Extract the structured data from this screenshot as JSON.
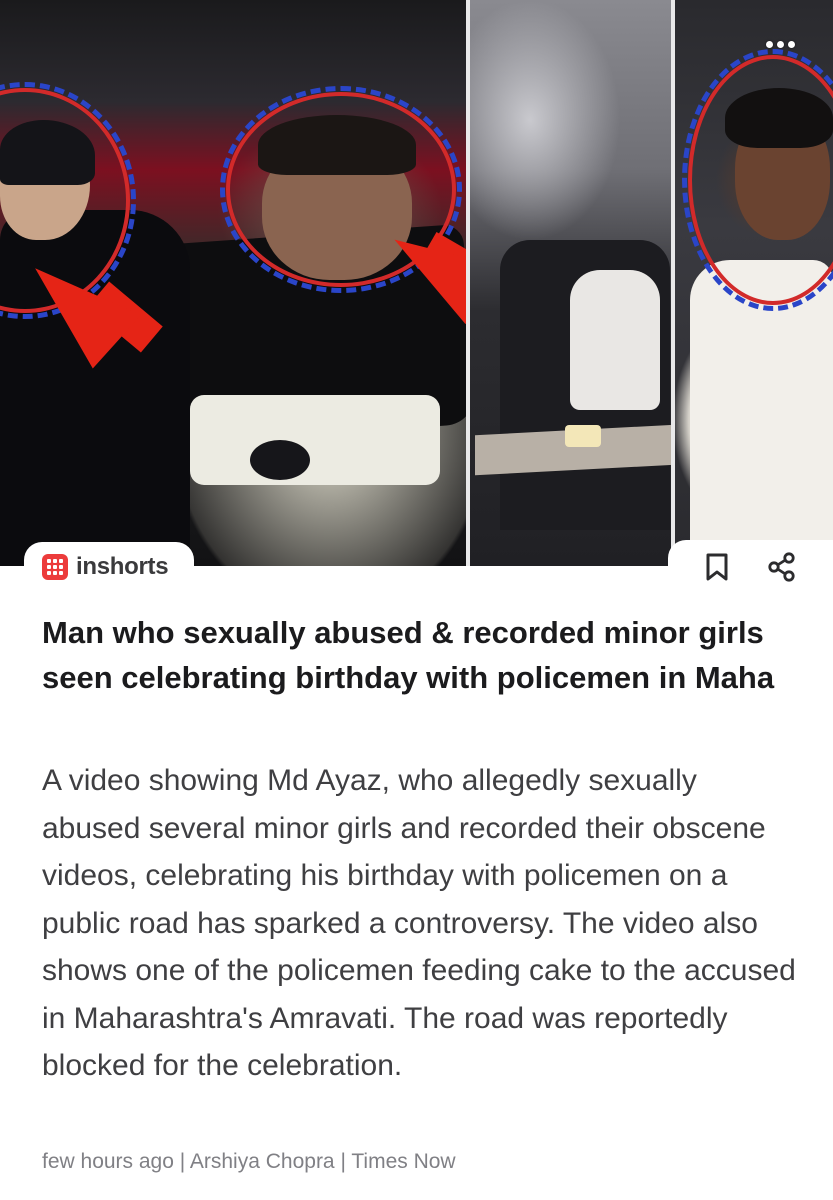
{
  "hero": {
    "image_description_icon": "photo-collage-icon"
  },
  "header": {
    "brand_name": "inshorts",
    "brand_color": "#ec3b3b",
    "more_icon": "more-horizontal-icon",
    "bookmark_icon": "bookmark-icon",
    "share_icon": "share-icon"
  },
  "article": {
    "headline": "Man who sexually abused & recorded minor girls seen celebrating birthday with policemen in Maha",
    "body": "A video showing Md Ayaz, who allegedly sexually abused several minor girls and recorded their obscene videos, celebrating his birthday with policemen on a public road has sparked a controversy. The video also shows one of the policemen feeding cake to the accused in Maharashtra's Amravati. The road was reportedly blocked for the celebration.",
    "byline": "few hours ago | Arshiya Chopra | Times Now"
  },
  "colors": {
    "annotation_circle": "#d22a2a",
    "annotation_dash": "#2a45c8",
    "arrow": "#e52416",
    "headline_text": "#1b1b1d",
    "body_text": "#3f3f42",
    "byline_text": "#808085"
  }
}
